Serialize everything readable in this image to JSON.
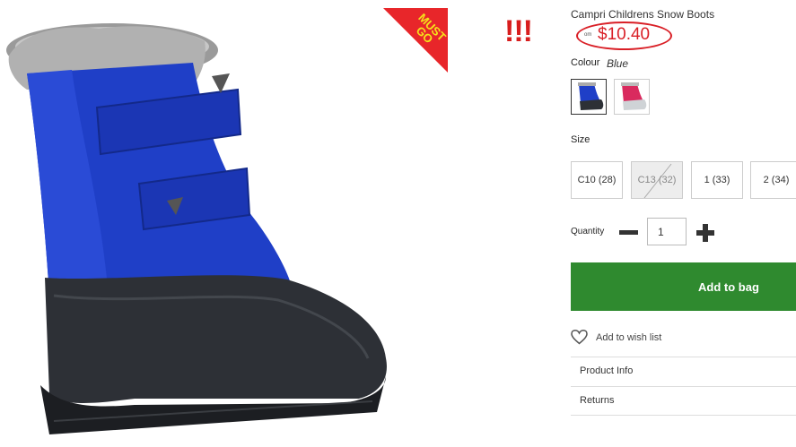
{
  "product": {
    "title": "Campri Childrens Snow Boots",
    "price_prefix": "om",
    "price": "$10.40",
    "badge": "MUST GO",
    "annotation": "!!!"
  },
  "colour": {
    "label": "Colour",
    "selected": "Blue",
    "swatches": [
      "blue-boot",
      "pink-boot"
    ]
  },
  "size": {
    "label": "Size",
    "options": [
      "C10 (28)",
      "C13 (32)",
      "1 (33)",
      "2 (34)"
    ],
    "unavailable": [
      "C13 (32)"
    ]
  },
  "quantity": {
    "label": "Quantity",
    "value": "1"
  },
  "actions": {
    "add_to_bag": "Add to bag",
    "wishlist": "Add to wish list"
  },
  "accordion": {
    "product_info": "Product Info",
    "returns": "Returns"
  },
  "colors": {
    "accent_red": "#d91f26",
    "add_button": "#2f8a2f",
    "boot_blue": "#1f3fc7"
  }
}
